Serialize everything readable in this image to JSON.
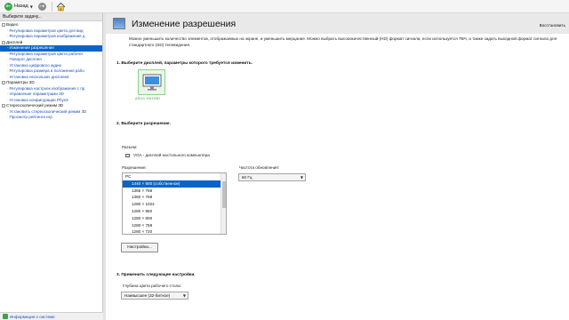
{
  "toolbar": {
    "back_label": "Назад"
  },
  "sidebar": {
    "header": "Выберите задачу...",
    "tree": [
      {
        "type": "cat",
        "label": "Видео"
      },
      {
        "type": "item",
        "label": "Регулировка параметров цвета для вид"
      },
      {
        "type": "item",
        "label": "Регулировка параметров изображения д"
      },
      {
        "type": "cat",
        "label": "Дисплей"
      },
      {
        "type": "item",
        "label": "Изменение разрешения",
        "selected": true
      },
      {
        "type": "item",
        "label": "Регулировка параметров цвета рабочег"
      },
      {
        "type": "item",
        "label": "Поворот дисплея"
      },
      {
        "type": "item",
        "label": "Установка цифрового аудио"
      },
      {
        "type": "item",
        "label": "Регулировка размера и положения рабо"
      },
      {
        "type": "item",
        "label": "Установка нескольких дисплеев"
      },
      {
        "type": "cat",
        "label": "Параметры 3D"
      },
      {
        "type": "item",
        "label": "Регулировка настроек изображения с пр"
      },
      {
        "type": "item",
        "label": "Управление параметрами 3D"
      },
      {
        "type": "item",
        "label": "Установка конфигурации PhysX"
      },
      {
        "type": "cat",
        "label": "Стереоскопический режим 3D"
      },
      {
        "type": "item",
        "label": "Установить стереоскопический режим 3D"
      },
      {
        "type": "item",
        "label": "Просмотр рейтинга игр"
      }
    ],
    "footer_link": "Информация о системе"
  },
  "main": {
    "title": "Изменение разрешения",
    "restore_link": "Восстановить",
    "description": "Можно уменьшить количество элементов, отображаемых на экране, и уменьшить мерцание. Можно выбрать высококачественный (HD) формат сигнала, если используется ТВЧ, а также задать выходной формат сигнала для стандартного (SD) телевидения.",
    "step1": "1. Выберите дисплей, параметры которого требуется изменить.",
    "display_name": "ASUS VW193D",
    "step2": "2. Выберите разрешение.",
    "connector_label": "Разъем:",
    "connector_value": "VGA - дисплей настольного компьютера",
    "resolution_label": "Разрешение:",
    "refresh_label": "Частота обновления:",
    "refresh_value": "60 Гц",
    "resolutions": [
      {
        "label": "PC",
        "group": true
      },
      {
        "label": "1440 × 900 (собственное)",
        "selected": true
      },
      {
        "label": "1366 × 768"
      },
      {
        "label": "1360 × 768"
      },
      {
        "label": "1280 × 1024"
      },
      {
        "label": "1280 × 960"
      },
      {
        "label": "1280 × 800"
      },
      {
        "label": "1280 × 768"
      },
      {
        "label": "1280 × 720"
      }
    ],
    "customize_button": "Настройка...",
    "step3": "3. Применить следующие настройки.",
    "depth_label": "Глубина цвета рабочего стола:",
    "depth_value": "Наивысшее (32-битное)"
  },
  "colors": {
    "accent": "#0a64c8",
    "nvidia_green": "#3aa547",
    "link": "#1a4fb8"
  },
  "icons": [
    "back-arrow-icon",
    "forward-arrow-icon",
    "home-icon",
    "monitor-icon",
    "vga-connector-icon",
    "info-icon",
    "display-settings-icon"
  ]
}
